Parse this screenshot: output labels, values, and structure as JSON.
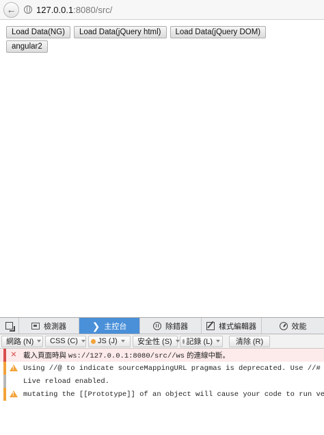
{
  "browser": {
    "url_host": "127.0.0.1",
    "url_rest": ":8080/src/",
    "back_glyph": "←"
  },
  "page": {
    "buttons_row1": [
      {
        "label": "Load Data(NG)"
      },
      {
        "label": "Load Data(jQuery html)"
      },
      {
        "label": "Load Data(jQuery DOM)"
      }
    ],
    "buttons_row2": [
      {
        "label": "angular2"
      }
    ]
  },
  "devtools": {
    "tabs": [
      {
        "label": "檢測器",
        "icon": "inspector-icon"
      },
      {
        "label": "主控台",
        "icon": "console-icon",
        "active": true
      },
      {
        "label": "除錯器",
        "icon": "debugger-icon"
      },
      {
        "label": "樣式編輯器",
        "icon": "style-editor-icon"
      },
      {
        "label": "效能",
        "icon": "performance-icon"
      }
    ],
    "console_glyph": "❯",
    "filters": [
      {
        "label": "網路 (N)",
        "color": "#222222"
      },
      {
        "label": "CSS (C)",
        "color": "#3a9ad9"
      },
      {
        "label": "JS (J)",
        "color": "#f2a33a"
      },
      {
        "label": "安全性 (S)",
        "color": "#d94d4d"
      },
      {
        "label": "記錄 (L)",
        "color": "#9a9a9a"
      }
    ],
    "clear_label": "清除 (R)",
    "messages": [
      {
        "level": "error",
        "glyph": "✕",
        "prefix": "載入頁面時與 ",
        "mono": "ws://127.0.0.1:8080/src//ws",
        "suffix": " 的連線中斷。"
      },
      {
        "level": "warn",
        "text": "Using //@ to indicate sourceMappingURL pragmas is deprecated. Use //# instead"
      },
      {
        "level": "log",
        "text": "Live reload enabled."
      },
      {
        "level": "warn",
        "text": "mutating the [[Prototype]] of an object will cause your code to run very slowl"
      }
    ],
    "colors": {
      "active_tab": "#4a90d9",
      "error": "#d94d4d",
      "warning": "#f3a23a",
      "log_text": "#e07b00"
    }
  }
}
